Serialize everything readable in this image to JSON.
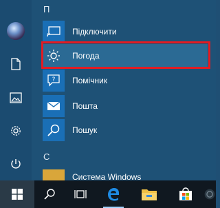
{
  "rail": {
    "items": [
      {
        "name": "avatar"
      },
      {
        "name": "document-icon"
      },
      {
        "name": "pictures-icon"
      },
      {
        "name": "gear-icon"
      },
      {
        "name": "power-icon"
      }
    ]
  },
  "list": {
    "section_p": "П",
    "items": [
      {
        "label": "Підключити",
        "icon": "connect-icon"
      },
      {
        "label": "Погода",
        "icon": "weather-sun-icon",
        "selected": true
      },
      {
        "label": "Помічник",
        "icon": "assistant-icon"
      },
      {
        "label": "Пошта",
        "icon": "mail-icon"
      },
      {
        "label": "Пошук",
        "icon": "search-icon"
      }
    ],
    "section_c": "С",
    "partial_item": "Система Windows"
  },
  "taskbar": {
    "items": [
      "start-icon",
      "search-icon",
      "task-view-icon",
      "edge-icon",
      "file-explorer-icon",
      "store-icon",
      "unknown-app-icon"
    ]
  },
  "colors": {
    "accent": "#1a6fb6",
    "highlight_border": "#e21c23",
    "start_bg": "#1e5176",
    "taskbar_bg": "#101820"
  }
}
